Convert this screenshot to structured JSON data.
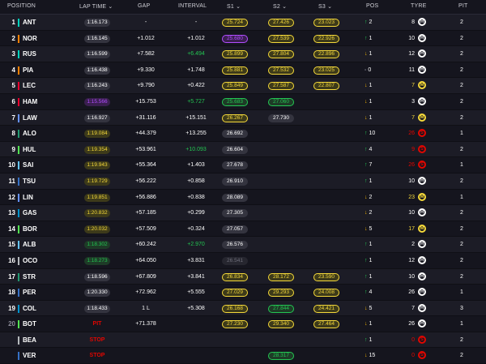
{
  "headers": {
    "position": "POSITION",
    "lap_time": "LAP TIME",
    "gap": "GAP",
    "interval": "INTERVAL",
    "s1": "S1",
    "s2": "S2",
    "s3": "S3",
    "pos": "POS",
    "tyre": "TYRE",
    "pit": "PIT"
  },
  "rows": [
    {
      "pos": "1",
      "code": "ANT",
      "team": "#00d2be",
      "lap": "1:16.173",
      "lap_c": "#ffffff",
      "gap": "-",
      "int": "-",
      "int_c": "#ffffff",
      "s1": "25.724",
      "s1_c": "yellow",
      "s2": "27.426",
      "s2_c": "yellow",
      "s3": "23.023",
      "s3_c": "yellow",
      "chg": "2",
      "dir": "up",
      "tl": "8",
      "tl_c": "#ffffff",
      "tyre": "H",
      "tyre_c": "#ffffff",
      "pit": "2"
    },
    {
      "pos": "2",
      "code": "NOR",
      "team": "#ff8000",
      "lap": "1:16.145",
      "lap_c": "#ffffff",
      "gap": "+1.012",
      "int": "+1.012",
      "int_c": "#ffffff",
      "s1": "25.680",
      "s1_c": "purple",
      "s2": "27.539",
      "s2_c": "yellow",
      "s3": "22.926",
      "s3_c": "yellow",
      "chg": "1",
      "dir": "up",
      "tl": "10",
      "tl_c": "#ffffff",
      "tyre": "H",
      "tyre_c": "#ffffff",
      "pit": "2"
    },
    {
      "pos": "3",
      "code": "RUS",
      "team": "#00d2be",
      "lap": "1:16.599",
      "lap_c": "#ffffff",
      "gap": "+7.582",
      "int": "+6.494",
      "int_c": "#23c552",
      "s1": "25.899",
      "s1_c": "yellow",
      "s2": "27.804",
      "s2_c": "yellow",
      "s3": "22.896",
      "s3_c": "yellow",
      "chg": "1",
      "dir": "down",
      "tl": "12",
      "tl_c": "#ffffff",
      "tyre": "H",
      "tyre_c": "#ffffff",
      "pit": "2"
    },
    {
      "pos": "4",
      "code": "PIA",
      "team": "#ff8000",
      "lap": "1:16.438",
      "lap_c": "#ffffff",
      "gap": "+9.330",
      "int": "+1.748",
      "int_c": "#ffffff",
      "s1": "25.881",
      "s1_c": "yellow",
      "s2": "27.532",
      "s2_c": "yellow",
      "s3": "23.025",
      "s3_c": "yellow",
      "chg": "0",
      "dir": "none",
      "tl": "11",
      "tl_c": "#ffffff",
      "tyre": "H",
      "tyre_c": "#ffffff",
      "pit": "2"
    },
    {
      "pos": "5",
      "code": "LEC",
      "team": "#e8002d",
      "lap": "1:16.243",
      "lap_c": "#ffffff",
      "gap": "+9.790",
      "int": "+0.422",
      "int_c": "#ffffff",
      "s1": "25.849",
      "s1_c": "yellow",
      "s2": "27.587",
      "s2_c": "yellow",
      "s3": "22.807",
      "s3_c": "yellow",
      "chg": "1",
      "dir": "down",
      "tl": "7",
      "tl_c": "#f4d83a",
      "tyre": "M",
      "tyre_c": "#f4d83a",
      "pit": "2"
    },
    {
      "pos": "6",
      "code": "HAM",
      "team": "#e8002d",
      "lap": "1:15.566",
      "lap_c": "#b14cff",
      "gap": "+15.753",
      "int": "+5.727",
      "int_c": "#23c552",
      "s1": "25.683",
      "s1_c": "green",
      "s2": "27.060",
      "s2_c": "green",
      "s3": "",
      "s3_c": "none",
      "chg": "1",
      "dir": "down",
      "tl": "3",
      "tl_c": "#ffffff",
      "tyre": "H",
      "tyre_c": "#ffffff",
      "pit": "2"
    },
    {
      "pos": "7",
      "code": "LAW",
      "team": "#6692ff",
      "lap": "1:16.927",
      "lap_c": "#ffffff",
      "gap": "+31.116",
      "int": "+15.151",
      "int_c": "#ffffff",
      "s1": "26.267",
      "s1_c": "yellow",
      "s2": "27.730",
      "s2_c": "white",
      "s3": "",
      "s3_c": "none",
      "chg": "1",
      "dir": "down",
      "tl": "7",
      "tl_c": "#f4d83a",
      "tyre": "M",
      "tyre_c": "#f4d83a",
      "pit": "2"
    },
    {
      "pos": "8",
      "code": "ALO",
      "team": "#229971",
      "lap": "1:19.084",
      "lap_c": "#ffffff",
      "gap": "+44.379",
      "int": "+13.255",
      "int_c": "#ffffff",
      "s1": "26.692",
      "s1_c": "white",
      "s2": "",
      "s2_c": "none",
      "s3": "",
      "s3_c": "none",
      "chg": "10",
      "dir": "up",
      "tl": "26",
      "tl_c": "#e10600",
      "tyre": "S",
      "tyre_c": "#e10600",
      "pit": "1"
    },
    {
      "pos": "9",
      "code": "HUL",
      "team": "#52e252",
      "lap": "1:19.354",
      "lap_c": "#ffffff",
      "gap": "+53.961",
      "int": "+10.093",
      "int_c": "#23c552",
      "s1": "26.604",
      "s1_c": "white",
      "s2": "",
      "s2_c": "none",
      "s3": "",
      "s3_c": "none",
      "chg": "4",
      "dir": "up",
      "tl": "9",
      "tl_c": "#e10600",
      "tyre": "S",
      "tyre_c": "#e10600",
      "pit": "2"
    },
    {
      "pos": "10",
      "code": "SAI",
      "team": "#64c4ff",
      "lap": "1:19.943",
      "lap_c": "#ffffff",
      "gap": "+55.364",
      "int": "+1.403",
      "int_c": "#ffffff",
      "s1": "27.678",
      "s1_c": "white",
      "s2": "",
      "s2_c": "none",
      "s3": "",
      "s3_c": "none",
      "chg": "7",
      "dir": "up",
      "tl": "26",
      "tl_c": "#e10600",
      "tyre": "S",
      "tyre_c": "#e10600",
      "pit": "1"
    },
    {
      "pos": "11",
      "code": "TSU",
      "team": "#3671c6",
      "lap": "1:19.729",
      "lap_c": "#ffffff",
      "gap": "+56.222",
      "int": "+0.858",
      "int_c": "#ffffff",
      "s1": "26.910",
      "s1_c": "white",
      "s2": "",
      "s2_c": "none",
      "s3": "",
      "s3_c": "none",
      "chg": "1",
      "dir": "up",
      "tl": "10",
      "tl_c": "#ffffff",
      "tyre": "H",
      "tyre_c": "#ffffff",
      "pit": "2"
    },
    {
      "pos": "12",
      "code": "LIN",
      "team": "#6692ff",
      "lap": "1:19.851",
      "lap_c": "#ffffff",
      "gap": "+56.886",
      "int": "+0.838",
      "int_c": "#ffffff",
      "s1": "28.089",
      "s1_c": "white",
      "s2": "",
      "s2_c": "none",
      "s3": "",
      "s3_c": "none",
      "chg": "2",
      "dir": "down",
      "tl": "23",
      "tl_c": "#f4d83a",
      "tyre": "M",
      "tyre_c": "#f4d83a",
      "pit": "1"
    },
    {
      "pos": "13",
      "code": "GAS",
      "team": "#0093cc",
      "lap": "1:20.832",
      "lap_c": "#ffffff",
      "gap": "+57.185",
      "int": "+0.299",
      "int_c": "#ffffff",
      "s1": "27.305",
      "s1_c": "white",
      "s2": "",
      "s2_c": "none",
      "s3": "",
      "s3_c": "none",
      "chg": "2",
      "dir": "down",
      "tl": "10",
      "tl_c": "#ffffff",
      "tyre": "H",
      "tyre_c": "#ffffff",
      "pit": "2"
    },
    {
      "pos": "14",
      "code": "BOR",
      "team": "#52e252",
      "lap": "1:20.032",
      "lap_c": "#ffffff",
      "gap": "+57.509",
      "int": "+0.324",
      "int_c": "#ffffff",
      "s1": "27.057",
      "s1_c": "white",
      "s2": "",
      "s2_c": "none",
      "s3": "",
      "s3_c": "none",
      "chg": "5",
      "dir": "down",
      "tl": "17",
      "tl_c": "#f4d83a",
      "tyre": "M",
      "tyre_c": "#f4d83a",
      "pit": "2"
    },
    {
      "pos": "15",
      "code": "ALB",
      "team": "#64c4ff",
      "lap": "1:18.302",
      "lap_c": "#23c552",
      "gap": "+60.242",
      "int": "+2.970",
      "int_c": "#23c552",
      "s1": "26.576",
      "s1_c": "white",
      "s2": "",
      "s2_c": "none",
      "s3": "",
      "s3_c": "none",
      "chg": "1",
      "dir": "up",
      "tl": "2",
      "tl_c": "#ffffff",
      "tyre": "H",
      "tyre_c": "#ffffff",
      "pit": "2"
    },
    {
      "pos": "16",
      "code": "OCO",
      "team": "#b6babd",
      "lap": "1:18.273",
      "lap_c": "#23c552",
      "gap": "+64.050",
      "int": "+3.831",
      "int_c": "#ffffff",
      "s1": "26.541",
      "s1_c": "grey",
      "s2": "",
      "s2_c": "none",
      "s3": "",
      "s3_c": "none",
      "chg": "1",
      "dir": "up",
      "tl": "12",
      "tl_c": "#ffffff",
      "tyre": "H",
      "tyre_c": "#ffffff",
      "pit": "2"
    },
    {
      "pos": "17",
      "code": "STR",
      "team": "#229971",
      "lap": "1:18.596",
      "lap_c": "#ffffff",
      "gap": "+67.809",
      "int": "+3.841",
      "int_c": "#ffffff",
      "s1": "26.834",
      "s1_c": "yellow",
      "s2": "28.172",
      "s2_c": "yellow",
      "s3": "23.590",
      "s3_c": "yellow",
      "chg": "1",
      "dir": "up",
      "tl": "10",
      "tl_c": "#ffffff",
      "tyre": "H",
      "tyre_c": "#ffffff",
      "pit": "2"
    },
    {
      "pos": "18",
      "code": "PER",
      "team": "#3671c6",
      "lap": "1:20.330",
      "lap_c": "#ffffff",
      "gap": "+72.962",
      "int": "+5.555",
      "int_c": "#ffffff",
      "s1": "27.029",
      "s1_c": "yellow",
      "s2": "29.293",
      "s2_c": "yellow",
      "s3": "24.008",
      "s3_c": "yellow",
      "chg": "4",
      "dir": "up",
      "tl": "26",
      "tl_c": "#ffffff",
      "tyre": "H",
      "tyre_c": "#ffffff",
      "pit": "1"
    },
    {
      "pos": "19",
      "code": "COL",
      "team": "#0093cc",
      "lap": "1:18.433",
      "lap_c": "#ffffff",
      "gap": "1 L",
      "int": "+5.308",
      "int_c": "#ffffff",
      "s1": "26.168",
      "s1_c": "yellow",
      "s2": "27.844",
      "s2_c": "green",
      "s3": "24.421",
      "s3_c": "yellow",
      "chg": "5",
      "dir": "down",
      "tl": "7",
      "tl_c": "#ffffff",
      "tyre": "H",
      "tyre_c": "#ffffff",
      "pit": "3"
    },
    {
      "pos": "20",
      "code": "BOT",
      "team": "#52e252",
      "lap": "PIT",
      "lap_c": "#e10600",
      "gap": "+71.378",
      "int": "",
      "int_c": "#ffffff",
      "s1": "27.230",
      "s1_c": "yellow",
      "s2": "29.340",
      "s2_c": "yellow",
      "s3": "27.464",
      "s3_c": "yellow",
      "chg": "1",
      "dir": "down",
      "tl": "26",
      "tl_c": "#ffffff",
      "tyre": "H",
      "tyre_c": "#ffffff",
      "pit": "1",
      "dimpos": true
    },
    {
      "pos": "",
      "code": "BEA",
      "team": "#b6babd",
      "lap": "STOP",
      "lap_c": "#e10600",
      "gap": "",
      "int": "",
      "int_c": "#ffffff",
      "s1": "",
      "s1_c": "none",
      "s2": "",
      "s2_c": "none",
      "s3": "",
      "s3_c": "none",
      "chg": "1",
      "dir": "up",
      "tl": "0",
      "tl_c": "#e10600",
      "tyre": "S",
      "tyre_c": "#e10600",
      "pit": "2"
    },
    {
      "pos": "",
      "code": "VER",
      "team": "#3671c6",
      "lap": "STOP",
      "lap_c": "#e10600",
      "gap": "",
      "int": "",
      "int_c": "#ffffff",
      "s1": "",
      "s1_c": "none",
      "s2": "28.317",
      "s2_c": "green",
      "s3": "",
      "s3_c": "none",
      "chg": "15",
      "dir": "down",
      "tl": "0",
      "tl_c": "#e10600",
      "tyre": "S",
      "tyre_c": "#e10600",
      "pit": "2"
    }
  ],
  "colors": {
    "background": "#15151e",
    "row_alt": "#1c1c26",
    "yellow": "#f4d83a",
    "green": "#23c552",
    "purple": "#b14cff",
    "red": "#e10600"
  }
}
